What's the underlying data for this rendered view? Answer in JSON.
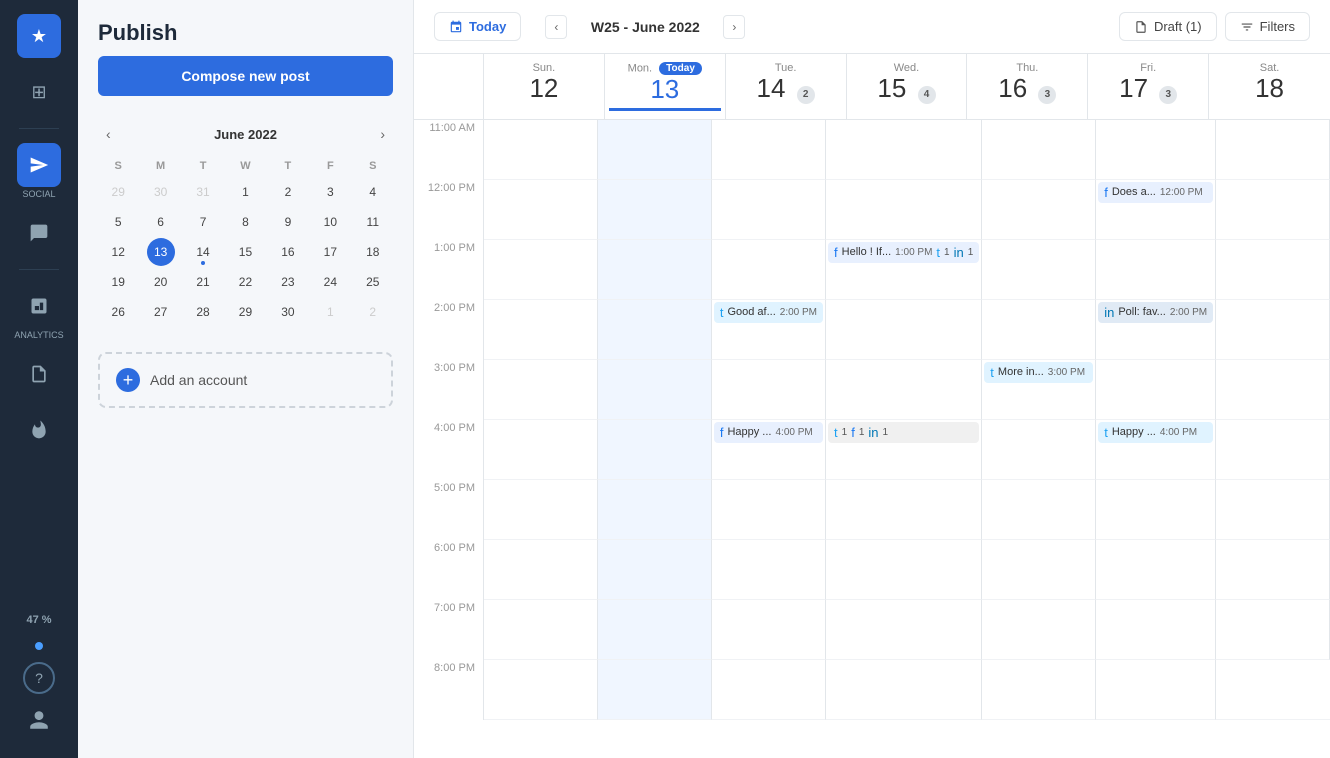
{
  "leftNav": {
    "icons": [
      {
        "name": "star-icon",
        "symbol": "★",
        "active": true
      },
      {
        "name": "grid-icon",
        "symbol": "⊞",
        "active": false
      },
      {
        "name": "send-icon",
        "symbol": "✈",
        "active": true,
        "label": "SOCIAL"
      },
      {
        "name": "chat-icon",
        "symbol": "💬",
        "active": false
      },
      {
        "name": "analytics-icon",
        "symbol": "📊",
        "active": false,
        "label": "ANALYTICS"
      },
      {
        "name": "report-icon",
        "symbol": "📄",
        "active": false
      },
      {
        "name": "fire-icon",
        "symbol": "🔥",
        "active": false
      }
    ],
    "percent": "47 %",
    "bottomIcons": [
      {
        "name": "help-icon",
        "symbol": "?"
      },
      {
        "name": "user-icon",
        "symbol": "👤"
      }
    ]
  },
  "sidebar": {
    "title": "Publish",
    "composeLabel": "Compose new post",
    "calendar": {
      "monthLabel": "June 2022",
      "dayHeaders": [
        "S",
        "M",
        "T",
        "W",
        "T",
        "F",
        "S"
      ],
      "weeks": [
        [
          {
            "day": 29,
            "otherMonth": true
          },
          {
            "day": 30,
            "otherMonth": true
          },
          {
            "day": 31,
            "otherMonth": true
          },
          {
            "day": 1
          },
          {
            "day": 2
          },
          {
            "day": 3
          },
          {
            "day": 4
          }
        ],
        [
          {
            "day": 5
          },
          {
            "day": 6
          },
          {
            "day": 7
          },
          {
            "day": 8
          },
          {
            "day": 9
          },
          {
            "day": 10
          },
          {
            "day": 11
          }
        ],
        [
          {
            "day": 12
          },
          {
            "day": 13,
            "today": true
          },
          {
            "day": 14,
            "hasDot": true
          },
          {
            "day": 15
          },
          {
            "day": 16
          },
          {
            "day": 17
          },
          {
            "day": 18
          }
        ],
        [
          {
            "day": 19
          },
          {
            "day": 20
          },
          {
            "day": 21
          },
          {
            "day": 22
          },
          {
            "day": 23
          },
          {
            "day": 24
          },
          {
            "day": 25
          }
        ],
        [
          {
            "day": 26
          },
          {
            "day": 27
          },
          {
            "day": 28
          },
          {
            "day": 29
          },
          {
            "day": 30
          },
          {
            "day": 1,
            "otherMonth": true
          },
          {
            "day": 2,
            "otherMonth": true
          }
        ]
      ]
    },
    "addAccountLabel": "Add an account"
  },
  "calendarHeader": {
    "todayLabel": "Today",
    "weekLabel": "W25 - June 2022",
    "draftLabel": "Draft (1)",
    "filtersLabel": "Filters"
  },
  "calendarDays": [
    {
      "dayName": "Sun.",
      "dayNum": "12",
      "isToday": false,
      "badge": ""
    },
    {
      "dayName": "Mon.",
      "dayNum": "13",
      "isToday": true,
      "badge": "",
      "todayTag": "Today"
    },
    {
      "dayName": "Tue.",
      "dayNum": "14",
      "isToday": false,
      "badge": "2"
    },
    {
      "dayName": "Wed.",
      "dayNum": "15",
      "isToday": false,
      "badge": "4"
    },
    {
      "dayName": "Thu.",
      "dayNum": "16",
      "isToday": false,
      "badge": "3"
    },
    {
      "dayName": "Fri.",
      "dayNum": "17",
      "isToday": false,
      "badge": "3"
    },
    {
      "dayName": "Sat.",
      "dayNum": "18",
      "isToday": false,
      "badge": ""
    }
  ],
  "timeSlots": [
    "11:00 AM",
    "12:00 PM",
    "1:00 PM",
    "2:00 PM",
    "3:00 PM",
    "4:00 PM",
    "5:00 PM",
    "6:00 PM",
    "7:00 PM",
    "8:00 PM"
  ],
  "events": [
    {
      "id": "e1",
      "day": 5,
      "timeSlot": 1,
      "platform": "fb",
      "text": "Does a...",
      "time": "12:00 PM"
    },
    {
      "id": "e2",
      "day": 4,
      "timeSlot": 2,
      "platform": "fb",
      "text": "Hello ! If...",
      "time": "1:00 PM",
      "badges": [
        {
          "platform": "tw",
          "count": 1
        },
        {
          "platform": "li",
          "count": 1
        }
      ]
    },
    {
      "id": "e3",
      "day": 2,
      "timeSlot": 3,
      "platform": "tw",
      "text": "Good af...",
      "time": "2:00 PM"
    },
    {
      "id": "e4",
      "day": 6,
      "timeSlot": 3,
      "platform": "li",
      "text": "Poll: fav...",
      "time": "2:00 PM"
    },
    {
      "id": "e5",
      "day": 5,
      "timeSlot": 4,
      "platform": "tw",
      "text": "More in...",
      "time": "3:00 PM"
    },
    {
      "id": "e6",
      "day": 2,
      "timeSlot": 5,
      "platform": "fb",
      "text": "Happy ...",
      "time": "4:00 PM"
    },
    {
      "id": "e6b",
      "day": 4,
      "timeSlot": 5,
      "platform": "multi",
      "badges": [
        {
          "platform": "tw",
          "count": 1
        },
        {
          "platform": "fb",
          "count": 1
        },
        {
          "platform": "li",
          "count": 1
        }
      ]
    },
    {
      "id": "e7",
      "day": 6,
      "timeSlot": 5,
      "platform": "tw",
      "text": "Happy ...",
      "time": "4:00 PM"
    }
  ]
}
